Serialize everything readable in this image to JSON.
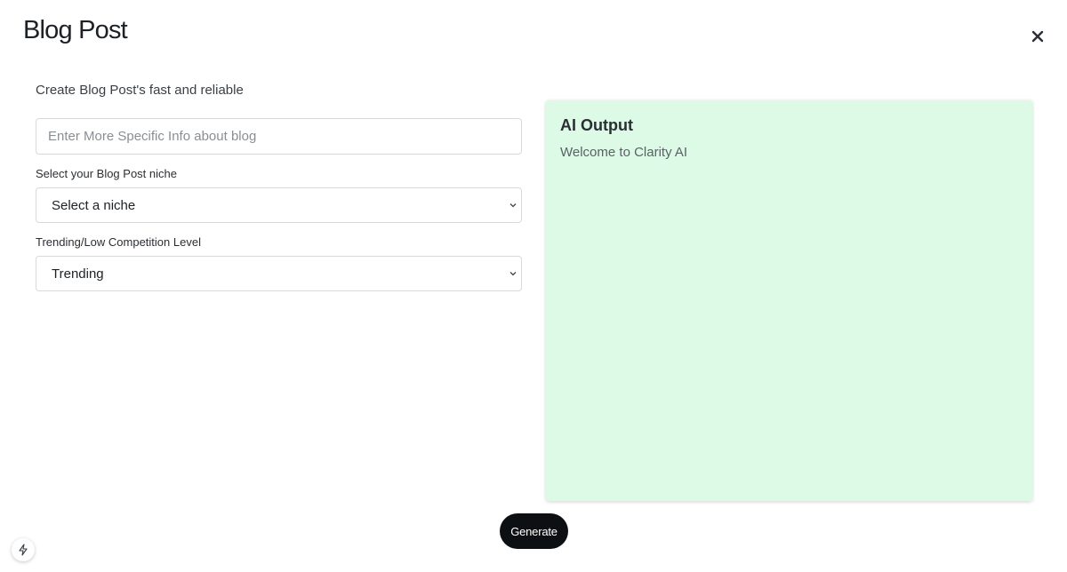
{
  "header": {
    "title": "Blog Post",
    "close_icon": "close-icon"
  },
  "form": {
    "subtitle": "Create Blog Post's fast and reliable",
    "info_input": {
      "placeholder": "Enter More Specific Info about blog",
      "value": ""
    },
    "niche": {
      "label": "Select your Blog Post niche",
      "selected": "Select a niche"
    },
    "competition": {
      "label": "Trending/Low Competition Level",
      "selected": "Trending"
    }
  },
  "output": {
    "title": "AI Output",
    "text": "Welcome to Clarity AI"
  },
  "actions": {
    "generate_label": "Generate"
  },
  "floating": {
    "icon": "bolt-icon"
  },
  "colors": {
    "output_bg": "#dcfae6",
    "button_bg": "#0d1012"
  }
}
